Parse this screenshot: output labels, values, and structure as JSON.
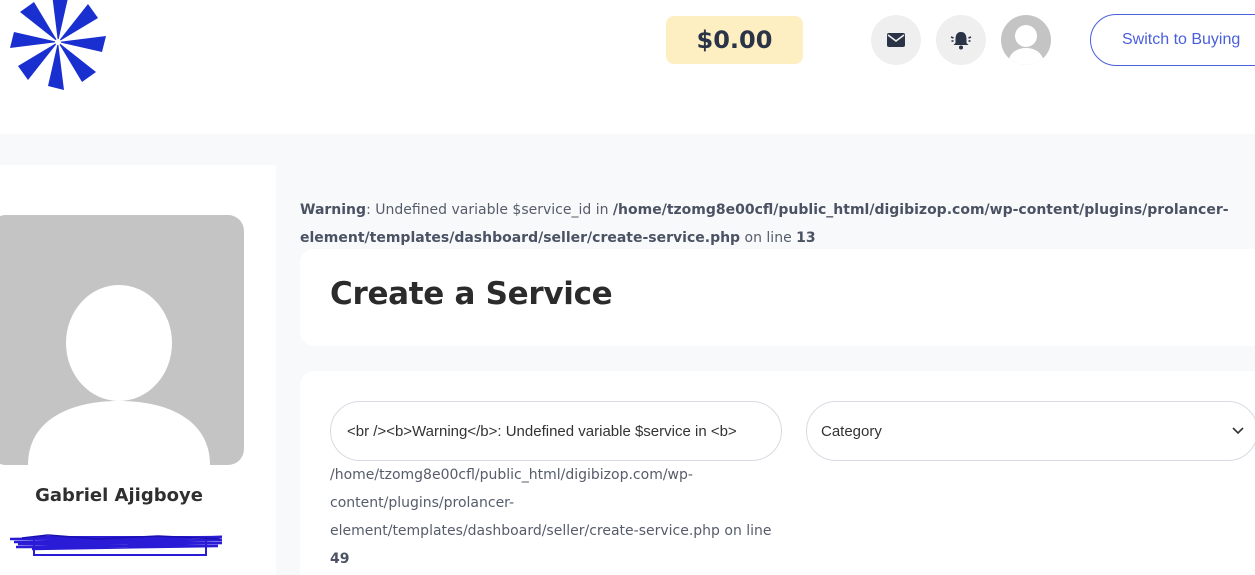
{
  "header": {
    "logo_name": "pinwheel-logo",
    "balance": "$0.00",
    "mail_icon": "envelope-icon",
    "bell_icon": "bell-icon",
    "switch_button": "Switch to Buying"
  },
  "sidebar": {
    "user_name": "Gabriel Ajigboye"
  },
  "php_warning": {
    "label": "Warning",
    "message": ": Undefined variable $service_id in ",
    "path": "/home/tzomg8e00cfl/public_html/digibizop.com/wp-content/plugins/prolancer-element/templates/dashboard/seller/create-service.php",
    "on_line": " on line ",
    "line": "13"
  },
  "page": {
    "title": "Create a Service"
  },
  "form": {
    "title_input_value": "<br /><b>Warning</b>:  Undefined variable $service in <b>",
    "category_value": "Category",
    "inline_warning_path": "/home/tzomg8e00cfl/public_html/digibizop.com/wp-content/plugins/prolancer-element/templates/dashboard/seller/create-service.php on line ",
    "inline_warning_line": "49"
  },
  "colors": {
    "accent": "#4a5fdc",
    "balance_bg": "#fdefc2",
    "logo": "#1a2fd0",
    "page_bg": "#f8f9fb"
  }
}
